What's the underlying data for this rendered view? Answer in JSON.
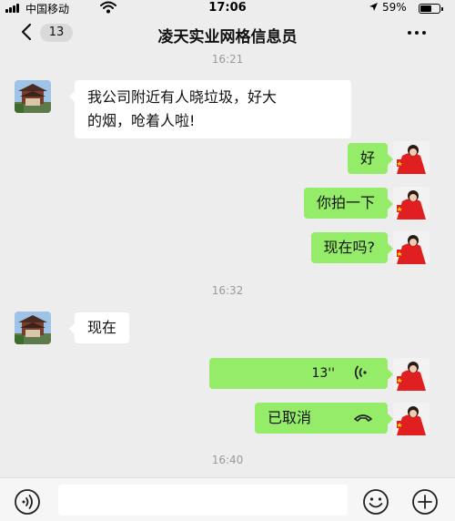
{
  "status_bar": {
    "carrier": "中国移动",
    "time": "17:06",
    "battery_percent": "59%",
    "battery_level": 0.59
  },
  "nav": {
    "unread_count": "13",
    "title": "凌天实业网格信息员"
  },
  "messages": {
    "ts1": "16:21",
    "m1": "我公司附近有人晓垃圾，好大的烟，呛着人啦!",
    "m1_line1": "我公司附近有人晓垃圾，好大",
    "m1_line2": "的烟，呛着人啦!",
    "m2": "好",
    "m3": "你拍一下",
    "m4": "现在吗?",
    "ts2": "16:32",
    "m5": "现在",
    "m6_voice_duration": "13''",
    "m7": "已取消",
    "ts3": "16:40"
  },
  "colors": {
    "background": "#ededed",
    "sent_bubble": "#95ec69",
    "received_bubble": "#ffffff"
  },
  "icons": {
    "back": "chevron-left-icon",
    "more": "more-dots-icon",
    "voice_message": "voice-wave-icon",
    "call_cancelled": "phone-hangup-icon",
    "voice_input": "voice-input-icon",
    "emoji": "emoji-icon",
    "plus": "plus-icon"
  }
}
